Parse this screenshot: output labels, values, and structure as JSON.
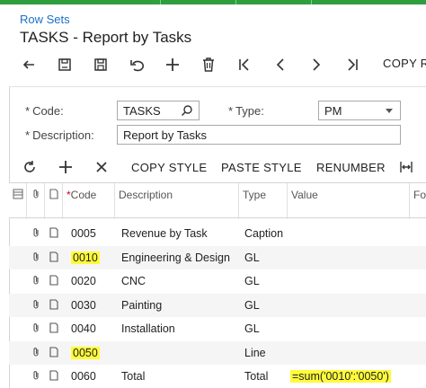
{
  "breadcrumb": "Row Sets",
  "page_title": "TASKS - Report by Tasks",
  "toolbar": {
    "copy_label": "COPY R"
  },
  "form": {
    "code_label": "Code:",
    "code_value": "TASKS",
    "type_label": "Type:",
    "type_value": "PM",
    "description_label": "Description:",
    "description_value": "Report by Tasks"
  },
  "grid_toolbar": {
    "copy_style": "COPY STYLE",
    "paste_style": "PASTE STYLE",
    "renumber": "RENUMBER"
  },
  "grid": {
    "columns": {
      "code": "Code",
      "description": "Description",
      "type": "Type",
      "value": "Value",
      "fo": "Fo"
    },
    "rows": [
      {
        "code": "0005",
        "description": "Revenue by Task",
        "type": "Caption",
        "value": ""
      },
      {
        "code": "0010",
        "description": "Engineering & Design",
        "type": "GL",
        "value": ""
      },
      {
        "code": "0020",
        "description": "CNC",
        "type": "GL",
        "value": ""
      },
      {
        "code": "0030",
        "description": "Painting",
        "type": "GL",
        "value": ""
      },
      {
        "code": "0040",
        "description": "Installation",
        "type": "GL",
        "value": ""
      },
      {
        "code": "0050",
        "description": "",
        "type": "Line",
        "value": ""
      },
      {
        "code": "0060",
        "description": "Total",
        "type": "Total",
        "value": "=sum('0010':'0050')"
      }
    ]
  },
  "colors": {
    "accent": "#1a6fc7",
    "topbar": "#2e9e3e",
    "highlight": "#fffb3a",
    "required": "#d0021b"
  }
}
